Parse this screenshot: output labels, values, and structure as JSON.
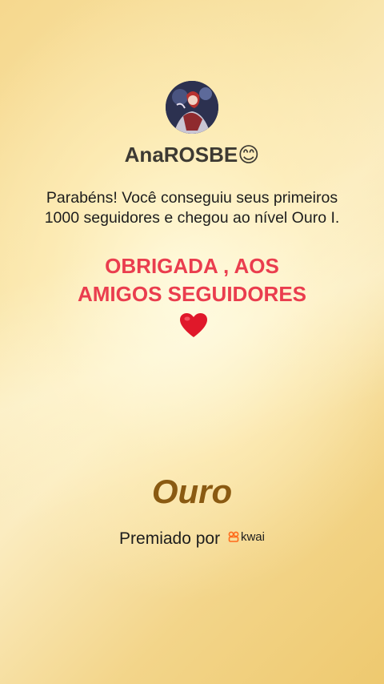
{
  "profile": {
    "username": "AnaROSBE😊",
    "avatar_icon": "profile-avatar"
  },
  "message": {
    "congrats": "Parabéns! Você conseguiu seus primeiros 1000 seguidores e chegou ao nível Ouro I.",
    "thanks_line1": "OBRIGADA , AOS",
    "thanks_line2": "AMIGOS SEGUIDORES",
    "heart_icon": "red-heart-icon"
  },
  "badge": {
    "level": "Ouro"
  },
  "award": {
    "prefix": "Premiado por",
    "brand": "kwai",
    "brand_icon": "kwai-logo-icon"
  },
  "colors": {
    "accent_red": "#ea3d4e",
    "gold_text": "#8a5a12",
    "background_gold": "#f8e3a6"
  }
}
